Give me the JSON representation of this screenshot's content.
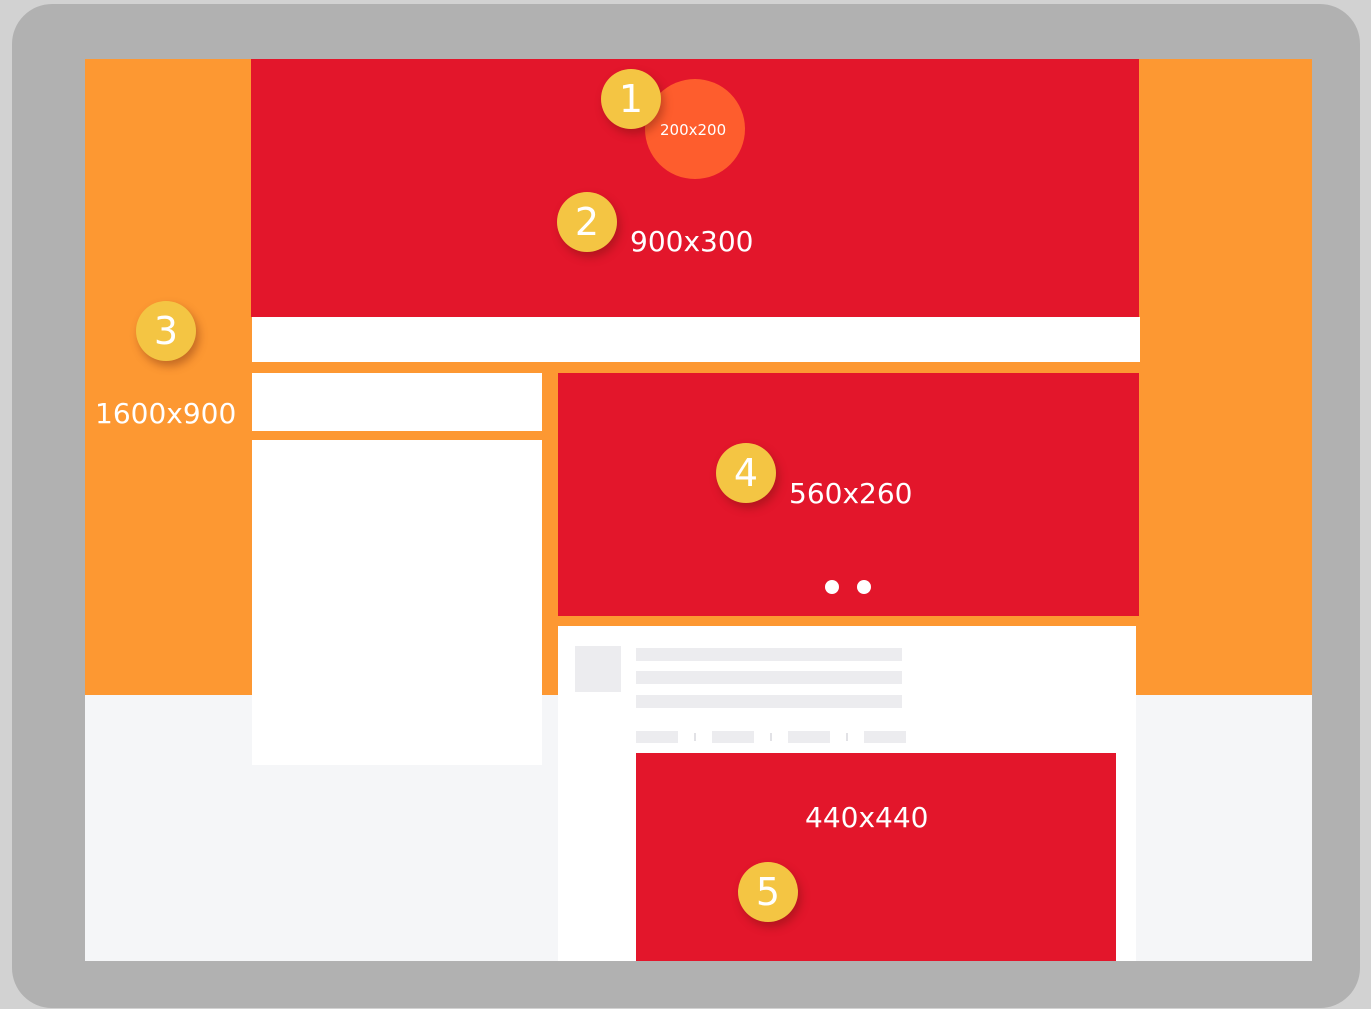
{
  "colors": {
    "cover": "#e3162b",
    "background_orange": "#fd9832",
    "profile_circle": "#fe5d2d",
    "badge": "#f4c543",
    "frame": "#b1b1b1",
    "page_background": "#f5f6f8",
    "placeholder_gray": "#ececef"
  },
  "labels": {
    "profile_photo": "200x200",
    "cover_photo": "900x300",
    "background_image": "1600x900",
    "slider_image": "560x260",
    "post_image": "440x440"
  },
  "badges": {
    "profile_photo": "1",
    "cover_photo": "2",
    "background_image": "3",
    "slider_image": "4",
    "post_image": "5"
  },
  "slider": {
    "dot_count": 2
  }
}
